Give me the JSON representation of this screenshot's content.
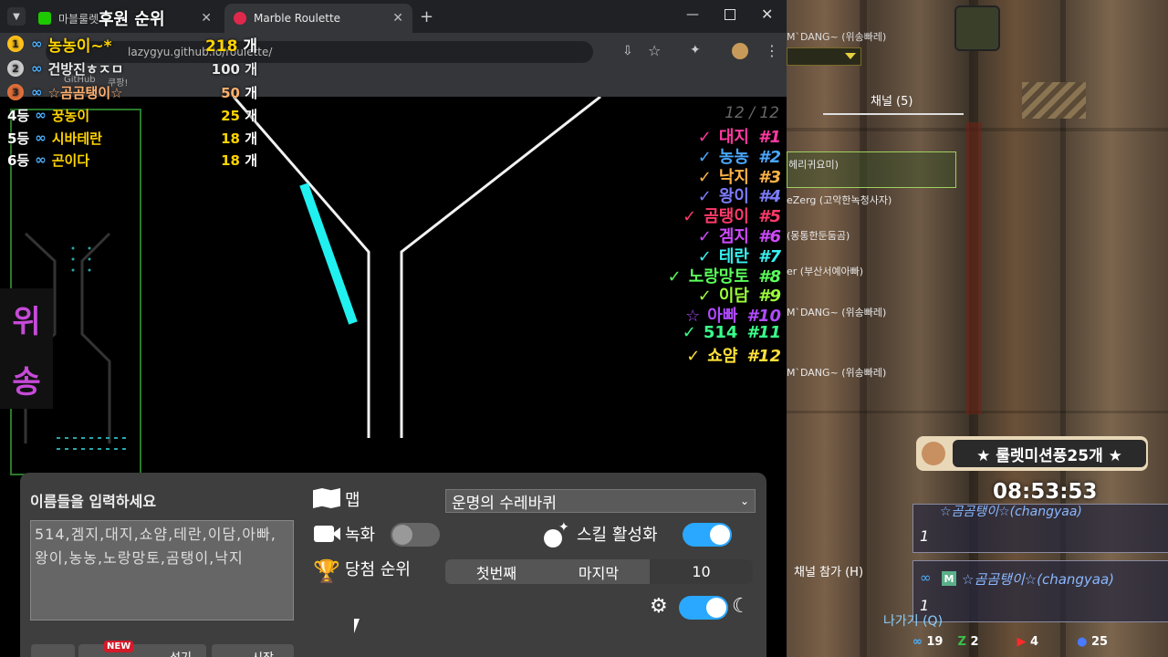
{
  "browser": {
    "tabs": [
      {
        "title": "마블룰렛",
        "active": false,
        "favicon_color": "#1ec800"
      },
      {
        "title": "Marble Roulette",
        "active": true,
        "favicon_color": "#e0284c"
      }
    ],
    "new_tab": "+",
    "url": "lazygyu.github.io/roulette/",
    "bookmarks": [
      "GitHub",
      "쿠팡!"
    ]
  },
  "overlay": {
    "title": "후원 순위",
    "ranks": [
      {
        "pos": "1",
        "name": "농농이~*",
        "amount": "218",
        "unit": "개",
        "color": "#ffd400"
      },
      {
        "pos": "2",
        "name": "건방진ㅎㅈㅁ",
        "amount": "100",
        "unit": "개",
        "color": "#e8e8e8"
      },
      {
        "pos": "3",
        "name": "☆곰곰탱이☆",
        "amount": "50",
        "unit": "개",
        "color": "#ff8a3d"
      },
      {
        "pos": "4등",
        "name": "꿍농이",
        "amount": "25",
        "unit": "개",
        "color": "#ffd400"
      },
      {
        "pos": "5등",
        "name": "시바테란",
        "amount": "18",
        "unit": "개",
        "color": "#ffd400"
      },
      {
        "pos": "6등",
        "name": "곤이다",
        "amount": "18",
        "unit": "개",
        "color": "#ffd400"
      }
    ],
    "side_text": [
      "위",
      "송"
    ]
  },
  "results": {
    "count": "12 / 12",
    "items": [
      {
        "name": "대지",
        "rank": "#1",
        "color": "#ff3aa0"
      },
      {
        "name": "농농",
        "rank": "#2",
        "color": "#4aa8ff"
      },
      {
        "name": "낙지",
        "rank": "#3",
        "color": "#ffb347"
      },
      {
        "name": "왕이",
        "rank": "#4",
        "color": "#7d7dff"
      },
      {
        "name": "곰탱이",
        "rank": "#5",
        "color": "#ff3a6a"
      },
      {
        "name": "겜지",
        "rank": "#6",
        "color": "#d04aff"
      },
      {
        "name": "테란",
        "rank": "#7",
        "color": "#3af0f0"
      },
      {
        "name": "노랑망토",
        "rank": "#8",
        "color": "#5aff5a"
      },
      {
        "name": "이담",
        "rank": "#9",
        "color": "#9cff3a"
      },
      {
        "name": "아빠",
        "rank": "#10",
        "color": "#b04aff",
        "mark": "☆"
      },
      {
        "name": "514",
        "rank": "#11",
        "color": "#3aff8a"
      },
      {
        "name": "쇼얌",
        "rank": "#12",
        "color": "#ffe03a"
      }
    ]
  },
  "panel": {
    "names_label": "이름들을 입력하세요",
    "names_value": "514,겜지,대지,쇼얌,테란,이담,아빠,왕이,농농,노랑망토,곰탱이,낙지",
    "map_label": "맵",
    "map_selected": "운명의 수레바퀴",
    "record_label": "녹화",
    "record_on": false,
    "skill_label": "스킬 활성화",
    "skill_on": true,
    "winner_label": "당첨 순위",
    "seg_first": "첫번째",
    "seg_last": "마지막",
    "seg_value": "10",
    "dark_on": true,
    "new_badge": "NEW",
    "bottom_buttons": [
      "섞기",
      "시작"
    ]
  },
  "game": {
    "player_top": "M`DANG~ (위송빠레)",
    "channel_tab": "채널 (5)",
    "list": [
      "헤리귀요미)",
      "eZerg (고악한녹청사자)",
      "(몽통한둔둠곰)",
      "er (부산서예아빠)",
      "M`DANG~ (위송빠레)",
      "M`DANG~ (위송빠레)"
    ],
    "banner": "★ 룰렛미션풍25개 ★",
    "clock": "08:53:53",
    "card1_name": "☆곰곰탱이☆(changyaa)",
    "card1_num": "1",
    "card2_name": "☆곰곰탱이☆(changyaa)",
    "card2_num": "1",
    "join": "채널 참가 (H)",
    "leave": "나가기 (Q)",
    "stats": [
      {
        "icon": "∞",
        "value": "19"
      },
      {
        "icon": "Z",
        "value": "2"
      },
      {
        "icon": "▶",
        "value": "4"
      },
      {
        "icon": "●",
        "value": "25"
      }
    ]
  }
}
